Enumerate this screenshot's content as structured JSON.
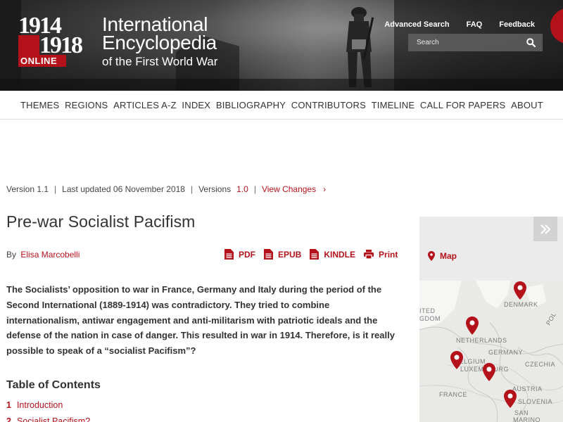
{
  "header": {
    "logo": {
      "year_top": "1914",
      "year_bottom": "1918",
      "online": "ONLINE"
    },
    "title_line1": "International",
    "title_line2": "Encyclopedia",
    "title_line3": "of the First World War",
    "links": [
      "Advanced Search",
      "FAQ",
      "Feedback"
    ],
    "search_placeholder": "Search"
  },
  "nav": [
    "THEMES",
    "REGIONS",
    "ARTICLES A-Z",
    "INDEX",
    "BIBLIOGRAPHY",
    "CONTRIBUTORS",
    "TIMELINE",
    "CALL FOR PAPERS",
    "ABOUT"
  ],
  "version_bar": {
    "version": "Version 1.1",
    "last_updated": "Last updated 06 November 2018",
    "versions_label": "Versions",
    "versions_link": "1.0",
    "view_changes": "View Changes",
    "chevron": "›"
  },
  "article": {
    "title": "Pre-war Socialist Pacifism",
    "by_label": "By",
    "author": "Elisa Marcobelli",
    "downloads": {
      "pdf": "PDF",
      "epub": "EPUB",
      "kindle": "KINDLE",
      "print": "Print"
    },
    "abstract": "The Socialists’ opposition to war in France, Germany and Italy during the period of the Second International (1889-1914) was contradictory. They tried to combine internationalism, antiwar engagement and anti-militarism with patriotic ideals and the defense of the nation in case of danger. This resulted in war in 1914. Therefore, is it really possible to speak of a “socialist Pacifism”?",
    "toc_title": "Table of Contents",
    "toc": [
      {
        "num": "1",
        "label": "Introduction"
      },
      {
        "num": "2",
        "label": "Socialist Pacifism?"
      }
    ]
  },
  "sidebar": {
    "map_label": "Map",
    "map_labels": {
      "denmark": "DENMARK",
      "uk1": "ITED",
      "uk2": "GDOM",
      "netherlands": "NETHERLANDS",
      "germany": "GERMANY",
      "belgium": "BELGIUM",
      "luxembourg": "LUXEMBOURG",
      "czechia": "CZECHIA",
      "france": "FRANCE",
      "austria": "AUSTRIA",
      "slovenia": "SLOVENIA",
      "san": "SAN",
      "marino": "MARINO",
      "pol": "POL"
    }
  },
  "colors": {
    "accent": "#b4121b",
    "text": "#333333",
    "sidebar_bg": "#ebebeb"
  }
}
